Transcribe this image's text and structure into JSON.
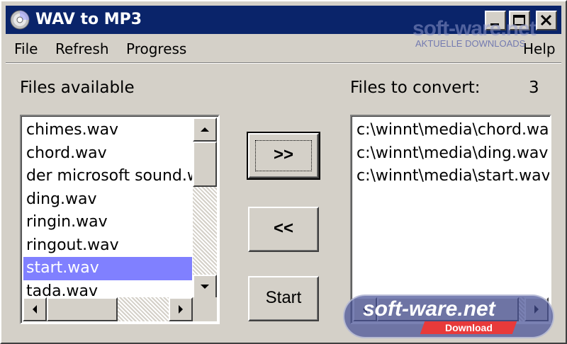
{
  "window": {
    "title": "WAV to MP3",
    "title_bar_color": "#0a246a"
  },
  "menu": {
    "file": "File",
    "refresh": "Refresh",
    "progress": "Progress",
    "help": "Help"
  },
  "labels": {
    "files_available": "Files available",
    "files_to_convert": "Files to convert:",
    "convert_count": "3"
  },
  "files_available": [
    "chimes.wav",
    "chord.wav",
    "der microsoft sound.wav",
    "ding.wav",
    "ringin.wav",
    "ringout.wav",
    "start.wav",
    "tada.wav"
  ],
  "selected_available": "start.wav",
  "files_to_convert": [
    "c:\\winnt\\media\\chord.wav",
    "c:\\winnt\\media\\ding.wav",
    "c:\\winnt\\media\\start.wav"
  ],
  "buttons": {
    "add": ">>",
    "remove": "<<",
    "start": "Start"
  },
  "watermark": {
    "top_brand": "soft-ware.net",
    "top_sub": "AKTUELLE DOWNLOADS",
    "badge_brand": "soft-ware.net",
    "badge_sub": "Download"
  },
  "colors": {
    "selection": "#8080ff",
    "face": "#d4d0c8"
  }
}
